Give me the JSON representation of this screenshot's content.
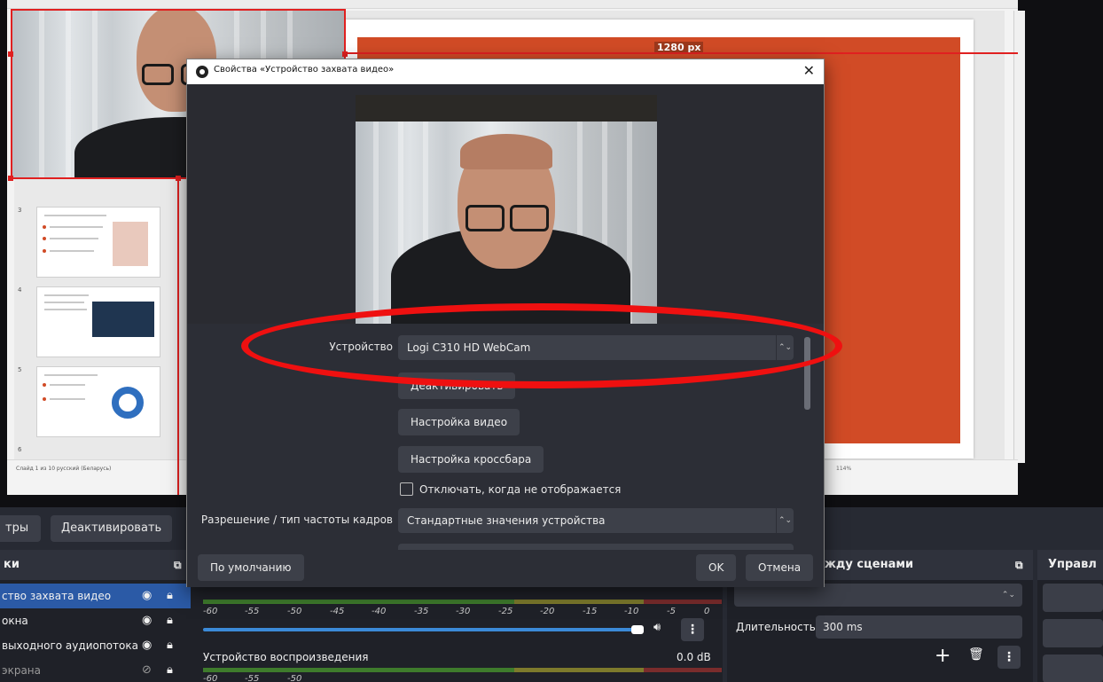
{
  "canvas": {
    "width_label": "1280 px",
    "ppt_status_left": "Слайд 1 из 10   русский (Беларусь)",
    "ppt_status_zoom": "114%",
    "slide_numbers": [
      "3",
      "4",
      "5",
      "6"
    ]
  },
  "toolbar": {
    "filters_label": "тры",
    "deactivate_label": "Деактивировать"
  },
  "sources_panel": {
    "header": "ки",
    "items": [
      {
        "label": "ство захвата видео",
        "selected": true
      },
      {
        "label": "окна",
        "selected": false
      },
      {
        "label": "выходного аудиопотока",
        "selected": false
      },
      {
        "label": "экрана",
        "selected": false
      }
    ]
  },
  "mixer": {
    "ticks": [
      "-60",
      "-55",
      "-50",
      "-45",
      "-40",
      "-35",
      "-30",
      "-25",
      "-20",
      "-15",
      "-10",
      "-5",
      "0"
    ],
    "playback_label": "Устройство воспроизведения",
    "playback_db": "0.0 dB",
    "volume_level": 0.84
  },
  "transitions": {
    "header": "жду сценами",
    "duration_label": "Длительность",
    "duration_value": "300 ms"
  },
  "controls": {
    "header": "Управл"
  },
  "dialog": {
    "title": "Свойства «Устройство захвата видео»",
    "close_glyph": "✕",
    "device_label": "Устройство",
    "device_value": "Logi C310 HD WebCam",
    "deactivate_button": "Деактивировать",
    "video_settings_button": "Настройка видео",
    "crossbar_button": "Настройка кроссбара",
    "hide_checkbox_label": "Отключать, когда не отображается",
    "hide_checkbox_checked": false,
    "resolution_label": "Разрешение / тип частоты кадров",
    "resolution_value": "Стандартные значения устройства",
    "defaults_button": "По умолчанию",
    "ok_button": "OK",
    "cancel_button": "Отмена"
  },
  "icons": {
    "eye": "eye-icon",
    "lock": "lock-icon",
    "eye_hidden": "eye-off-icon",
    "speaker": "speaker-icon",
    "menu": "kebab-menu-icon",
    "add": "plus-icon",
    "delete": "trash-icon",
    "undock": "undock-icon"
  },
  "colors": {
    "accent_selected": "#2b5aa6",
    "slide_red": "#d14b26",
    "annotation_red": "#ef1010"
  }
}
